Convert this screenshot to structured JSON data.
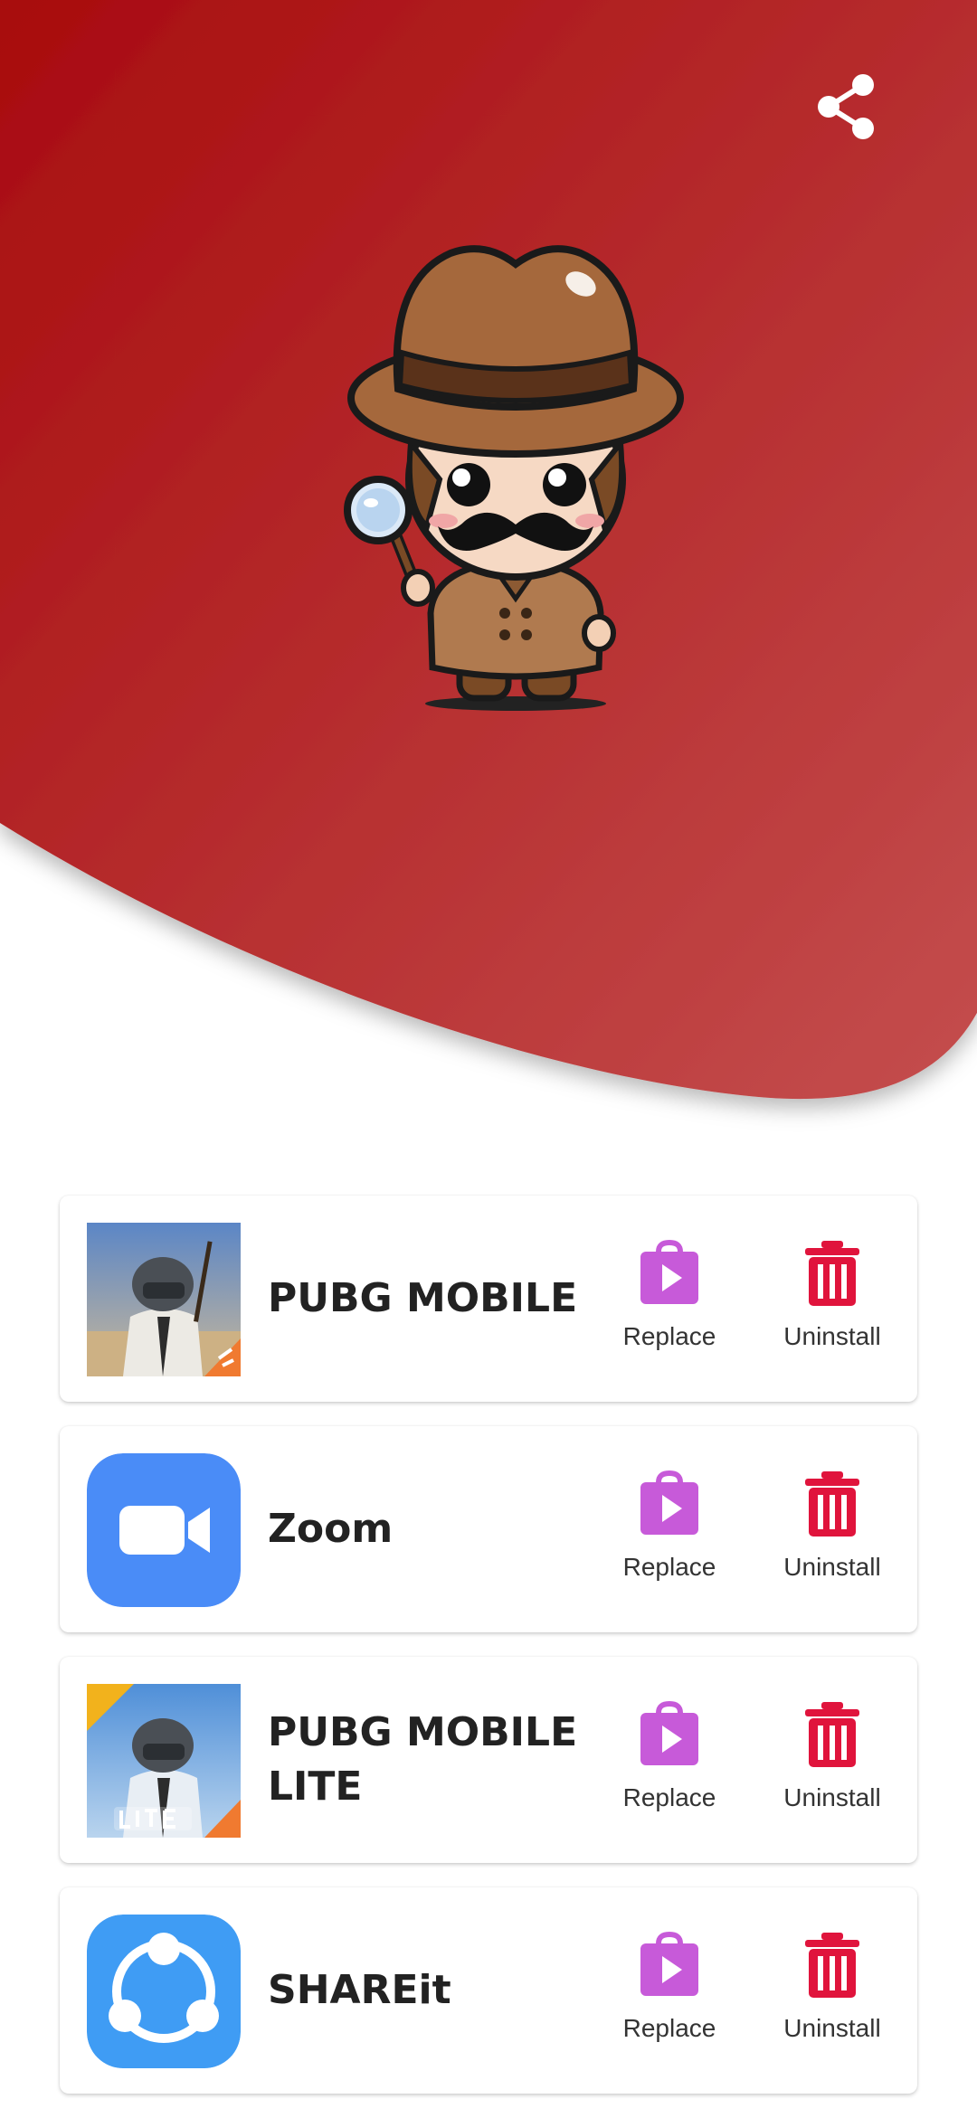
{
  "colors": {
    "hero_top": "#a80b0e",
    "hero_bottom": "#c24a4a",
    "replace_icon": "#c75ad9",
    "uninstall_icon": "#e0143c"
  },
  "header": {
    "share_icon": "share-icon",
    "mascot": "detective-mascot"
  },
  "apps": [
    {
      "name": "PUBG MOBILE",
      "icon": "pubg-mobile-icon",
      "replace_label": "Replace",
      "uninstall_label": "Uninstall"
    },
    {
      "name": "Zoom",
      "icon": "zoom-icon",
      "replace_label": "Replace",
      "uninstall_label": "Uninstall"
    },
    {
      "name": "PUBG MOBILE LITE",
      "icon": "pubg-mobile-lite-icon",
      "replace_label": "Replace",
      "uninstall_label": "Uninstall"
    },
    {
      "name": "SHAREit",
      "icon": "shareit-icon",
      "replace_label": "Replace",
      "uninstall_label": "Uninstall"
    }
  ]
}
